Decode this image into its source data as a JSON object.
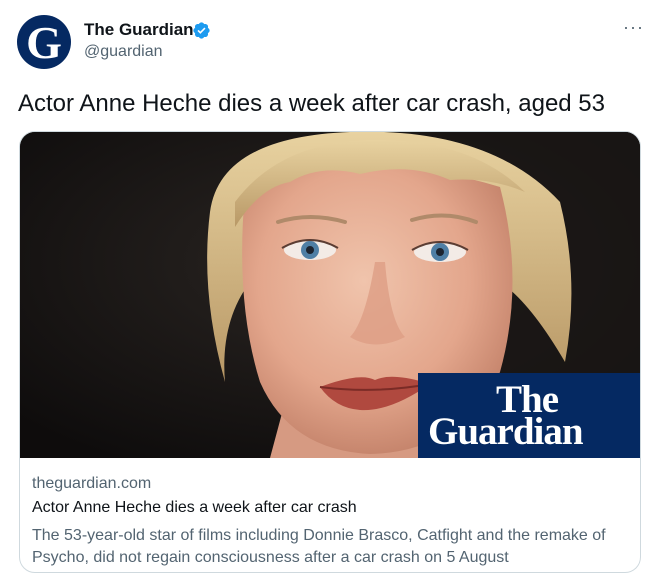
{
  "author": {
    "display_name": "The Guardian",
    "handle": "@guardian",
    "avatar_letter": "G",
    "verified": true,
    "brand_color": "#052962"
  },
  "tweet": {
    "text": "Actor Anne Heche dies a week after car crash, aged 53"
  },
  "menu": {
    "more_icon": "more-horizontal-icon",
    "label": "···"
  },
  "card": {
    "domain": "theguardian.com",
    "title": "Actor Anne Heche dies a week after car crash",
    "description": "The 53-year-old star of films including Donnie Brasco, Catfight and the remake of Psycho, did not regain consciousness after a car crash on 5 August",
    "logo": {
      "line1": "The",
      "line2": "Guardian",
      "background": "#052962"
    }
  },
  "colors": {
    "text_primary": "#0f1419",
    "text_secondary": "#536471",
    "verified_blue": "#1d9bf0",
    "card_border": "#cfd9de"
  }
}
